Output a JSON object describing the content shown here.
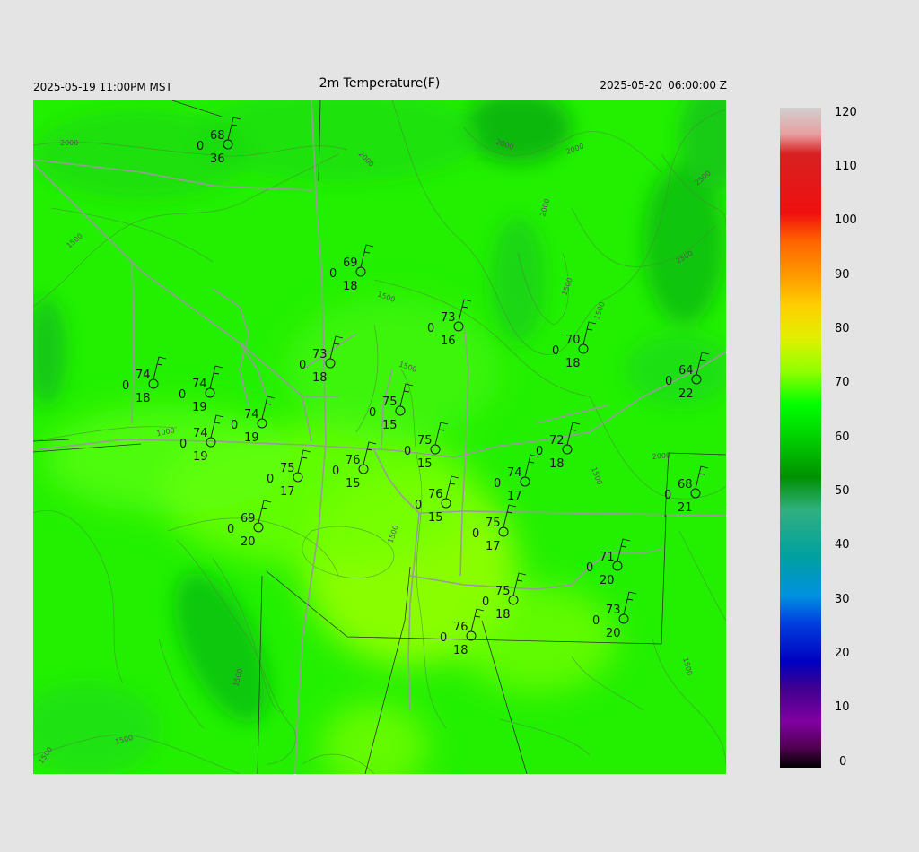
{
  "header": {
    "title": "2m Temperature(F)",
    "local_time": "2025-05-19 11:00PM MST",
    "valid_time": "2025-05-20_06:00:00 Z"
  },
  "colorbar": {
    "labels": [
      "120",
      "110",
      "100",
      "90",
      "80",
      "70",
      "60",
      "50",
      "40",
      "30",
      "20",
      "10",
      "0"
    ],
    "colors": [
      "#d0d0d0",
      "#e8a0a0",
      "#d82020",
      "#f01010",
      "#ff6000",
      "#ffa000",
      "#ffd000",
      "#e0f000",
      "#90ff00",
      "#00ff00",
      "#00d000",
      "#009000",
      "#30b080",
      "#00a0a0",
      "#0090e0",
      "#0040e0",
      "#0000c0",
      "#400090",
      "#8000a0",
      "#500050",
      "#000000"
    ]
  },
  "contours": {
    "labels": [
      "2000",
      "2000",
      "2000",
      "2000",
      "2000",
      "2500",
      "2500",
      "1500",
      "1500",
      "1500",
      "1500",
      "1500",
      "1000",
      "1500",
      "1500",
      "1500",
      "1500",
      "2000",
      "1500",
      "1500"
    ]
  },
  "stations": [
    {
      "temp": "68",
      "zero": "0",
      "dew": "36"
    },
    {
      "temp": "69",
      "zero": "0",
      "dew": "18"
    },
    {
      "temp": "73",
      "zero": "0",
      "dew": "16"
    },
    {
      "temp": "70",
      "zero": "0",
      "dew": "18"
    },
    {
      "temp": "73",
      "zero": "0",
      "dew": "18"
    },
    {
      "temp": "74",
      "zero": "0",
      "dew": "18"
    },
    {
      "temp": "74",
      "zero": "0",
      "dew": "19"
    },
    {
      "temp": "74",
      "zero": "0",
      "dew": "19"
    },
    {
      "temp": "74",
      "zero": "0",
      "dew": "19"
    },
    {
      "temp": "75",
      "zero": "0",
      "dew": "15"
    },
    {
      "temp": "75",
      "zero": "0",
      "dew": "15"
    },
    {
      "temp": "76",
      "zero": "0",
      "dew": "15"
    },
    {
      "temp": "75",
      "zero": "0",
      "dew": "17"
    },
    {
      "temp": "72",
      "zero": "0",
      "dew": "18"
    },
    {
      "temp": "74",
      "zero": "0",
      "dew": "17"
    },
    {
      "temp": "76",
      "zero": "0",
      "dew": "15"
    },
    {
      "temp": "64",
      "zero": "0",
      "dew": "22"
    },
    {
      "temp": "68",
      "zero": "0",
      "dew": "21"
    },
    {
      "temp": "69",
      "zero": "0",
      "dew": "20"
    },
    {
      "temp": "75",
      "zero": "0",
      "dew": "17"
    },
    {
      "temp": "71",
      "zero": "0",
      "dew": "20"
    },
    {
      "temp": "75",
      "zero": "0",
      "dew": "18"
    },
    {
      "temp": "73",
      "zero": "0",
      "dew": "20"
    },
    {
      "temp": "76",
      "zero": "0",
      "dew": "18"
    }
  ]
}
